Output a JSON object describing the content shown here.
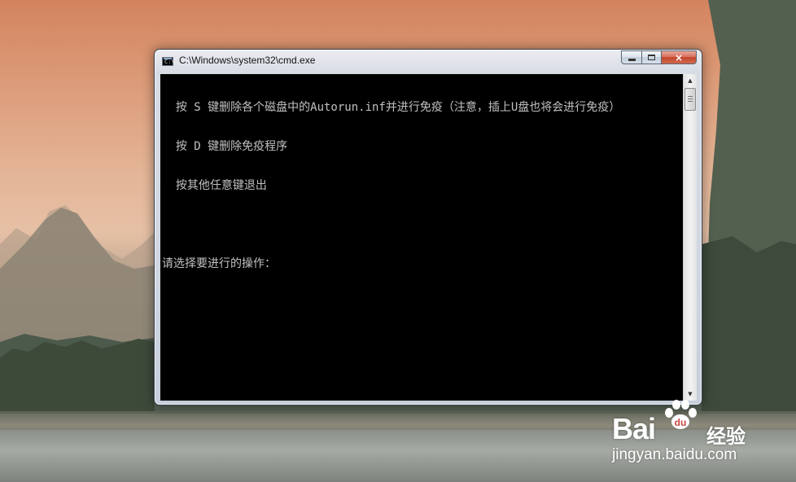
{
  "window": {
    "title": "C:\\Windows\\system32\\cmd.exe",
    "icon": "cmd-icon",
    "buttons": {
      "minimize": "minimize-icon",
      "maximize": "maximize-icon",
      "close": "×"
    }
  },
  "console": {
    "lines": [
      "  按 S 键删除各个磁盘中的Autorun.inf并进行免疫（注意，插上U盘也将会进行免疫）",
      "  按 D 键删除免疫程序",
      "  按其他任意键退出",
      "",
      "请选择要进行的操作："
    ],
    "background": "#000000",
    "foreground": "#c0c0c0"
  },
  "watermark": {
    "logo": "Bai",
    "logo_suffix": "经验",
    "url": "jingyan.baidu.com"
  }
}
